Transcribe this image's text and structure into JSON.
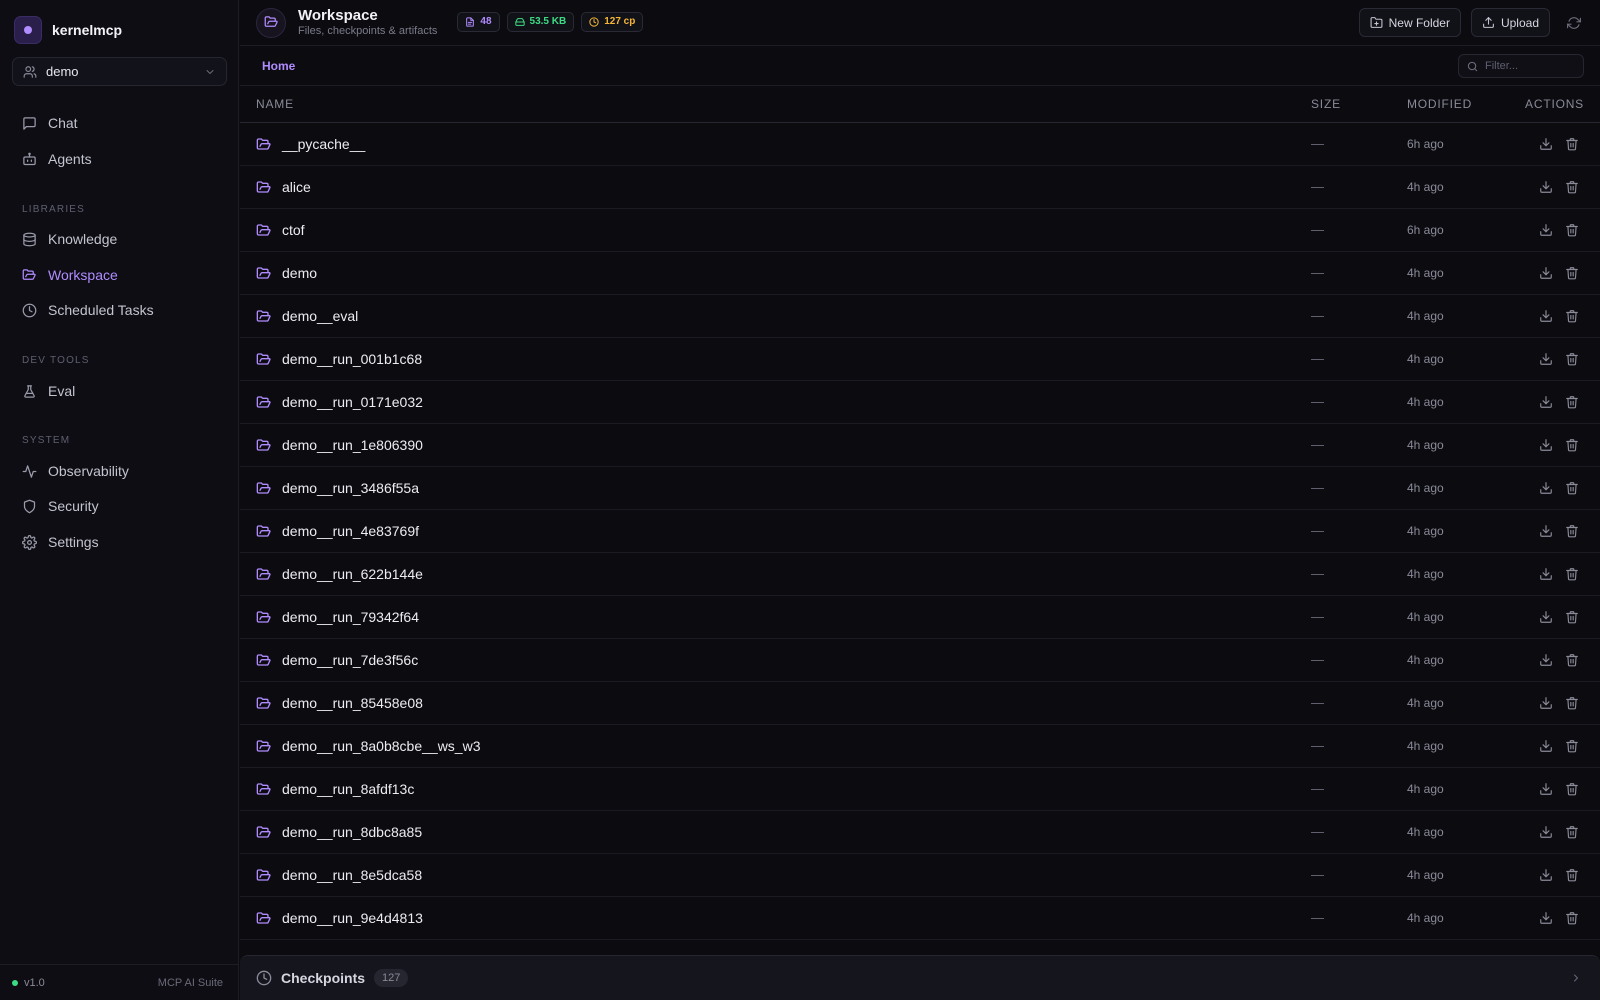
{
  "brand": {
    "name": "kernelmcp"
  },
  "user_select": {
    "value": "demo"
  },
  "nav": {
    "main": [
      {
        "label": "Chat",
        "icon": "message-square-icon"
      },
      {
        "label": "Agents",
        "icon": "bot-icon"
      }
    ],
    "libraries_title": "LIBRARIES",
    "libraries": [
      {
        "label": "Knowledge",
        "icon": "database-icon"
      },
      {
        "label": "Workspace",
        "icon": "folder-open-icon",
        "active": true
      },
      {
        "label": "Scheduled Tasks",
        "icon": "clock-icon"
      }
    ],
    "devtools_title": "DEV TOOLS",
    "devtools": [
      {
        "label": "Eval",
        "icon": "flask-icon"
      }
    ],
    "system_title": "SYSTEM",
    "system": [
      {
        "label": "Observability",
        "icon": "activity-icon"
      },
      {
        "label": "Security",
        "icon": "shield-icon"
      },
      {
        "label": "Settings",
        "icon": "gear-icon"
      }
    ]
  },
  "footer": {
    "version": "v1.0",
    "suite": "MCP AI Suite",
    "status_color": "#3ddc84"
  },
  "header": {
    "title": "Workspace",
    "subtitle": "Files, checkpoints & artifacts",
    "badges": {
      "files": "48",
      "size": "53.5 KB",
      "checkpoints": "127 cp"
    },
    "new_folder_label": "New Folder",
    "upload_label": "Upload"
  },
  "toolbar": {
    "breadcrumb": "Home",
    "filter_placeholder": "Filter..."
  },
  "table": {
    "columns": {
      "name": "NAME",
      "size": "SIZE",
      "modified": "MODIFIED",
      "actions": "ACTIONS"
    },
    "rows": [
      {
        "name": "__pycache__",
        "size": "—",
        "modified": "6h ago"
      },
      {
        "name": "alice",
        "size": "—",
        "modified": "4h ago"
      },
      {
        "name": "ctof",
        "size": "—",
        "modified": "6h ago"
      },
      {
        "name": "demo",
        "size": "—",
        "modified": "4h ago"
      },
      {
        "name": "demo__eval",
        "size": "—",
        "modified": "4h ago"
      },
      {
        "name": "demo__run_001b1c68",
        "size": "—",
        "modified": "4h ago"
      },
      {
        "name": "demo__run_0171e032",
        "size": "—",
        "modified": "4h ago"
      },
      {
        "name": "demo__run_1e806390",
        "size": "—",
        "modified": "4h ago"
      },
      {
        "name": "demo__run_3486f55a",
        "size": "—",
        "modified": "4h ago"
      },
      {
        "name": "demo__run_4e83769f",
        "size": "—",
        "modified": "4h ago"
      },
      {
        "name": "demo__run_622b144e",
        "size": "—",
        "modified": "4h ago"
      },
      {
        "name": "demo__run_79342f64",
        "size": "—",
        "modified": "4h ago"
      },
      {
        "name": "demo__run_7de3f56c",
        "size": "—",
        "modified": "4h ago"
      },
      {
        "name": "demo__run_85458e08",
        "size": "—",
        "modified": "4h ago"
      },
      {
        "name": "demo__run_8a0b8cbe__ws_w3",
        "size": "—",
        "modified": "4h ago"
      },
      {
        "name": "demo__run_8afdf13c",
        "size": "—",
        "modified": "4h ago"
      },
      {
        "name": "demo__run_8dbc8a85",
        "size": "—",
        "modified": "4h ago"
      },
      {
        "name": "demo__run_8e5dca58",
        "size": "—",
        "modified": "4h ago"
      },
      {
        "name": "demo__run_9e4d4813",
        "size": "—",
        "modified": "4h ago"
      }
    ]
  },
  "checkpoints": {
    "label": "Checkpoints",
    "count": "127"
  },
  "colors": {
    "accent": "#b08cff",
    "size_badge": "#3ddc84",
    "cp_badge": "#f5b638"
  }
}
